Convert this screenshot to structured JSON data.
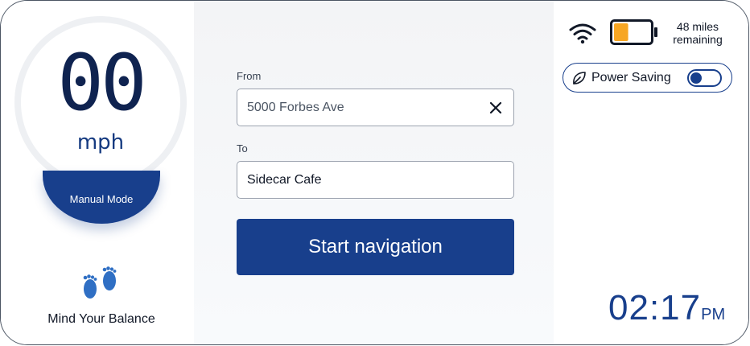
{
  "speedometer": {
    "speed": "00",
    "unit": "mph",
    "mode": "Manual Mode"
  },
  "balance": {
    "icon": "footprints-icon",
    "label": "Mind Your Balance"
  },
  "navigation": {
    "from_label": "From",
    "from_value": "5000 Forbes Ave",
    "to_label": "To",
    "to_value": "Sidecar Cafe",
    "start_button": "Start navigation"
  },
  "status": {
    "wifi_icon": "wifi-icon",
    "battery_icon": "battery-icon",
    "battery_level": 0.4,
    "range_line1": "48 miles",
    "range_line2": "remaining"
  },
  "power_saving": {
    "icon": "leaf-icon",
    "label": "Power Saving",
    "enabled": false
  },
  "clock": {
    "time": "02:17",
    "ampm": "PM"
  },
  "colors": {
    "accent": "#183f8c",
    "battery_fill": "#f7a623",
    "speed_digits": "#0f2350"
  }
}
